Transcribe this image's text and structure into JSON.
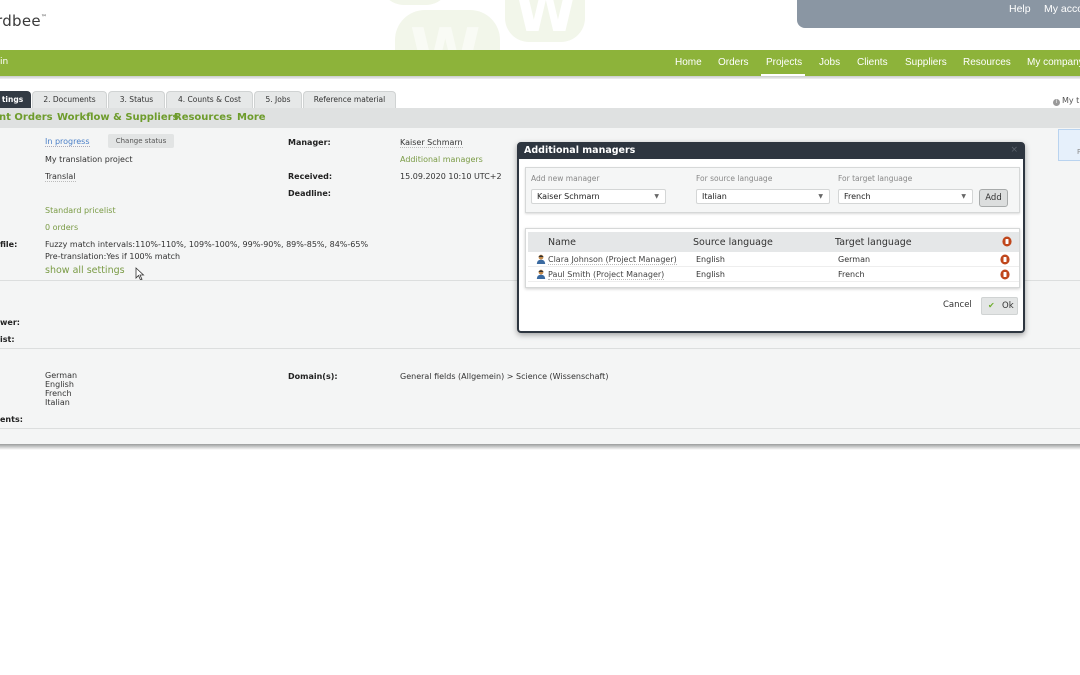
{
  "header": {
    "logo_text": "rdbee",
    "logo_tm": "™",
    "account_links": [
      "Help",
      "My acco"
    ]
  },
  "nav": {
    "left_fragment": "in",
    "items": [
      "Home",
      "Orders",
      "Projects",
      "Jobs",
      "Clients",
      "Suppliers",
      "Resources",
      "My company"
    ],
    "active": "Projects"
  },
  "tabs": {
    "items": [
      "tings",
      "2. Documents",
      "3. Status",
      "4. Counts & Cost",
      "5. Jobs",
      "Reference material"
    ],
    "active_index": 0,
    "right_hint": "My t"
  },
  "subnav": {
    "items": [
      "nt Orders",
      "Workflow & Suppliers",
      "Resources",
      "More"
    ]
  },
  "project": {
    "status": "In progress",
    "change_status_label": "Change status",
    "name": "My translation project",
    "type": "Translal",
    "pricelist": "Standard pricelist",
    "orders": "0 orders",
    "profile_label_fragment": "file:",
    "fuzzy_intervals": "Fuzzy match intervals:110%-110%, 109%-100%, 99%-90%, 89%-85%, 84%-65%",
    "pre_translation": "Pre-translation:Yes if 100% match",
    "show_all_settings": "show all settings",
    "manager_label": "Manager:",
    "manager_value": "Kaiser Schmarn",
    "additional_managers_link": "Additional managers",
    "received_label": "Received:",
    "received_value": "15.09.2020 10:10 UTC+2",
    "deadline_label": "Deadline:",
    "reviewer_label_fragment": "wer:",
    "list_label_fragment": "ist:",
    "languages": [
      "German",
      "English",
      "French",
      "Italian"
    ],
    "domains_label": "Domain(s):",
    "domains_value": "General fields (Allgemein) > Science (Wissenschaft)",
    "comments_label_fragment": "ents:",
    "right_panel_fragment": "P"
  },
  "modal": {
    "title": "Additional managers",
    "close_icon": "×",
    "add_new_manager_label": "Add new manager",
    "add_new_manager_value": "Kaiser Schmarn",
    "source_language_label": "For source language",
    "source_language_value": "Italian",
    "target_language_label": "For target language",
    "target_language_value": "French",
    "add_label": "Add",
    "table": {
      "headers": [
        "Name",
        "Source language",
        "Target language"
      ],
      "rows": [
        {
          "name": "Clara Johnson (Project Manager)",
          "source": "English",
          "target": "German"
        },
        {
          "name": "Paul Smith (Project Manager)",
          "source": "English",
          "target": "French"
        }
      ]
    },
    "cancel_label": "Cancel",
    "ok_label": "Ok"
  },
  "colors": {
    "brand_green": "#8db33a",
    "link_green": "#7a9b45",
    "dark_header": "#2e3640",
    "account_bar": "#8a96a3",
    "delete_red": "#c0471c"
  }
}
